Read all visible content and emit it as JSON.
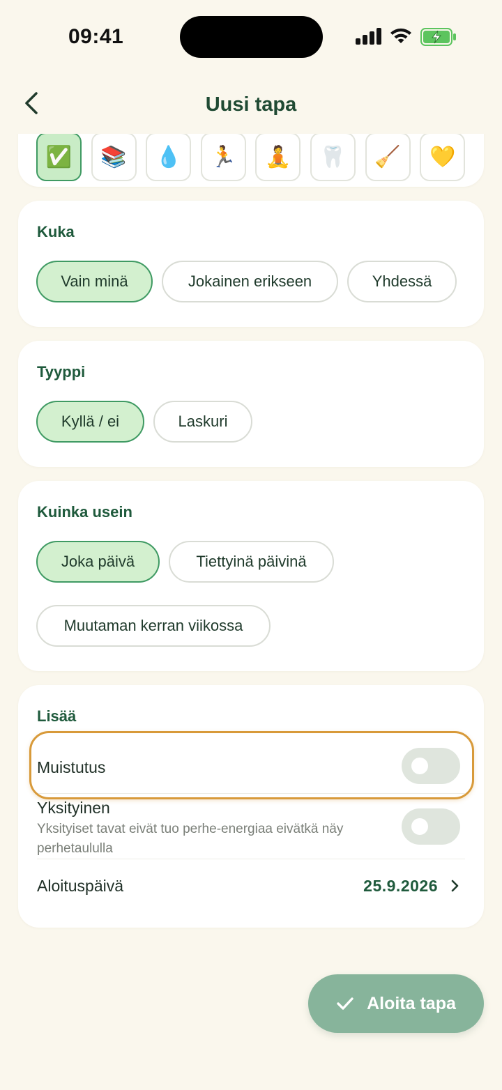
{
  "status_bar": {
    "time": "09:41"
  },
  "nav": {
    "title": "Uusi tapa"
  },
  "icons": {
    "items": [
      {
        "name": "checkmark-emoji",
        "glyph": "✅",
        "selected": true
      },
      {
        "name": "books-emoji",
        "glyph": "📚",
        "selected": false
      },
      {
        "name": "droplet-emoji",
        "glyph": "💧",
        "selected": false
      },
      {
        "name": "runner-emoji",
        "glyph": "🏃",
        "selected": false
      },
      {
        "name": "meditation-emoji",
        "glyph": "🧘",
        "selected": false
      },
      {
        "name": "tooth-emoji",
        "glyph": "🦷",
        "selected": false
      },
      {
        "name": "broom-emoji",
        "glyph": "🧹",
        "selected": false
      },
      {
        "name": "heart-emoji",
        "glyph": "💛",
        "selected": false
      }
    ]
  },
  "who": {
    "title": "Kuka",
    "options": [
      "Vain minä",
      "Jokainen erikseen",
      "Yhdessä"
    ],
    "selected": "Vain minä"
  },
  "type": {
    "title": "Tyyppi",
    "options": [
      "Kyllä / ei",
      "Laskuri"
    ],
    "selected": "Kyllä / ei"
  },
  "frequency": {
    "title": "Kuinka usein",
    "options": [
      "Joka päivä",
      "Tiettyinä päivinä",
      "Muutaman kerran viikossa"
    ],
    "selected": "Joka päivä"
  },
  "more": {
    "title": "Lisää",
    "reminder_label": "Muistutus",
    "reminder_on": false,
    "private_label": "Yksityinen",
    "private_sub": "Yksityiset tavat eivät tuo perhe-energiaa eivätkä näy perhetaululla",
    "private_on": false,
    "start_label": "Aloituspäivä",
    "start_value": "25.9.2026"
  },
  "colors": {
    "accent": "#1f5a3c",
    "selected_fill": "#d3f0cf",
    "selected_border": "#3f9a63",
    "highlight": "#d89a3a",
    "fab": "#87b49b"
  },
  "fab": {
    "label": "Aloita tapa"
  }
}
